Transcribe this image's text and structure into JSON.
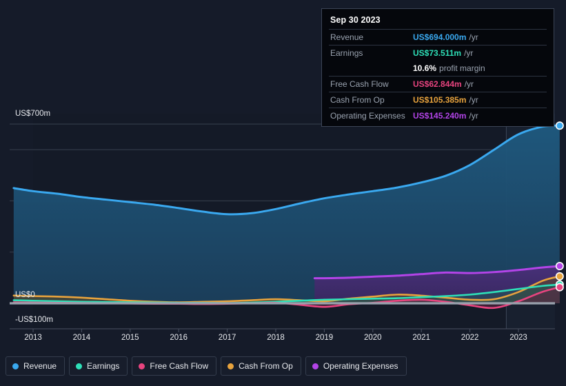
{
  "tooltip": {
    "date": "Sep 30 2023",
    "rows": [
      {
        "label": "Revenue",
        "value": "US$694.000m",
        "unit": "/yr",
        "color": "#3aa9f0"
      },
      {
        "label": "Earnings",
        "value": "US$73.511m",
        "unit": "/yr",
        "color": "#2ee0b8"
      },
      {
        "label": "",
        "value": "10.6%",
        "unit": "profit margin",
        "color": "#ffffff",
        "sub": true
      },
      {
        "label": "Free Cash Flow",
        "value": "US$62.844m",
        "unit": "/yr",
        "color": "#e8447f"
      },
      {
        "label": "Cash From Op",
        "value": "US$105.385m",
        "unit": "/yr",
        "color": "#e8a33d"
      },
      {
        "label": "Operating Expenses",
        "value": "US$145.240m",
        "unit": "/yr",
        "color": "#b344e8"
      }
    ]
  },
  "legend": {
    "items": [
      {
        "label": "Revenue",
        "color": "#3aa9f0"
      },
      {
        "label": "Earnings",
        "color": "#2ee0b8"
      },
      {
        "label": "Free Cash Flow",
        "color": "#e8447f"
      },
      {
        "label": "Cash From Op",
        "color": "#e8a33d"
      },
      {
        "label": "Operating Expenses",
        "color": "#b344e8"
      }
    ]
  },
  "axis": {
    "y_labels": [
      {
        "text": "US$700m",
        "top": 159
      },
      {
        "text": "US$0",
        "top": 422
      },
      {
        "text": "-US$100m",
        "top": 458
      }
    ],
    "x_labels": [
      "2013",
      "2014",
      "2015",
      "2016",
      "2017",
      "2018",
      "2019",
      "2020",
      "2021",
      "2022",
      "2023"
    ]
  },
  "chart_data": {
    "type": "area",
    "title": "",
    "xlabel": "",
    "ylabel": "US$",
    "ylim": [
      -100,
      700
    ],
    "xlim": [
      2012.6,
      2023.9
    ],
    "grid": true,
    "legend_position": "bottom",
    "gridline_values": [
      700,
      600,
      400,
      200,
      0
    ],
    "zero_line": 0,
    "forecast_divider_x": 2022.75,
    "x": [
      2012.6,
      2013.0,
      2013.5,
      2014.0,
      2014.5,
      2015.0,
      2015.5,
      2016.0,
      2016.5,
      2017.0,
      2017.5,
      2018.0,
      2018.5,
      2019.0,
      2019.5,
      2020.0,
      2020.5,
      2021.0,
      2021.5,
      2022.0,
      2022.5,
      2023.0,
      2023.5,
      2023.85
    ],
    "series": [
      {
        "name": "Revenue",
        "color": "#3aa9f0",
        "fill": "#1d4a6b",
        "values": [
          450,
          438,
          428,
          415,
          405,
          395,
          385,
          372,
          358,
          348,
          352,
          368,
          390,
          410,
          425,
          438,
          452,
          472,
          498,
          540,
          600,
          660,
          690,
          694
        ]
      },
      {
        "name": "Earnings",
        "color": "#2ee0b8",
        "fill": "#1d5a55",
        "values": [
          12,
          10,
          8,
          6,
          5,
          4,
          3,
          2,
          2,
          1,
          3,
          6,
          10,
          14,
          16,
          18,
          20,
          24,
          28,
          34,
          44,
          56,
          68,
          73.511
        ]
      },
      {
        "name": "Free Cash Flow",
        "color": "#e8447f",
        "fill": "#5e2340",
        "values": [
          4,
          3,
          2,
          1,
          0,
          -1,
          -2,
          -2,
          -3,
          -2,
          0,
          2,
          -6,
          -14,
          -4,
          2,
          10,
          14,
          6,
          -8,
          -18,
          8,
          45,
          62.844
        ]
      },
      {
        "name": "Cash From Op",
        "color": "#e8a33d",
        "fill": "#5e4a22",
        "values": [
          30,
          28,
          26,
          22,
          16,
          10,
          6,
          4,
          6,
          8,
          12,
          16,
          12,
          8,
          18,
          26,
          34,
          30,
          22,
          14,
          16,
          44,
          88,
          105.385
        ]
      },
      {
        "name": "Operating Expenses",
        "color": "#b344e8",
        "fill": "#3e2a63",
        "start_x": 2018.8,
        "values": [
          null,
          null,
          null,
          null,
          null,
          null,
          null,
          null,
          null,
          null,
          null,
          null,
          null,
          98,
          100,
          104,
          108,
          114,
          120,
          118,
          122,
          130,
          140,
          145.24
        ]
      }
    ]
  }
}
